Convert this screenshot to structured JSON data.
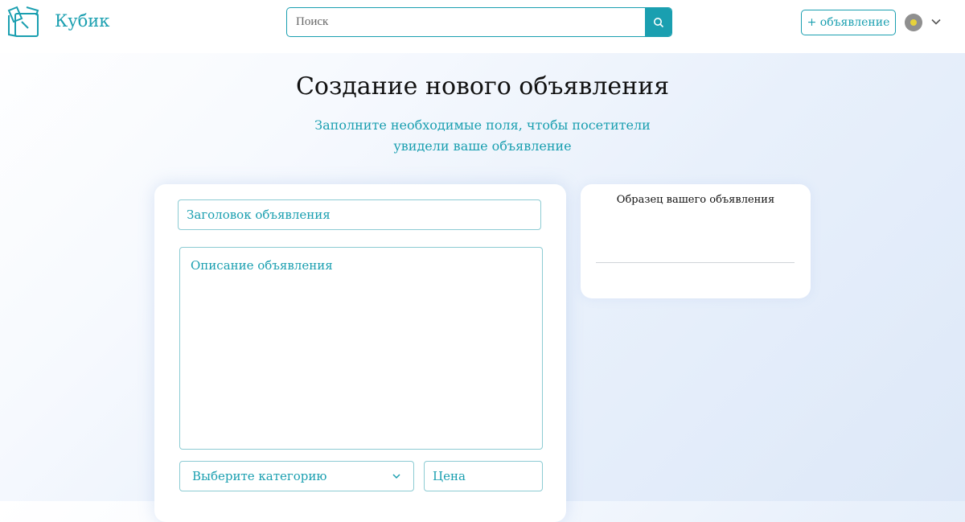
{
  "header": {
    "logo_text": "Кубик",
    "search_placeholder": "Поиск",
    "add_button_label": "+ объявление"
  },
  "page": {
    "title": "Создание нового объявления",
    "subtitle_line1": "Заполните необходимые поля, чтобы посетители",
    "subtitle_line2": "увидели ваше объявление"
  },
  "form": {
    "title_placeholder": "Заголовок объявления",
    "description_placeholder": "Описание объявления",
    "category_placeholder": "Выберите категорию",
    "price_placeholder": "Цена"
  },
  "preview": {
    "title": "Образец вашего объявления"
  },
  "colors": {
    "accent": "#1a9fb0",
    "border": "#8ccbd3"
  }
}
